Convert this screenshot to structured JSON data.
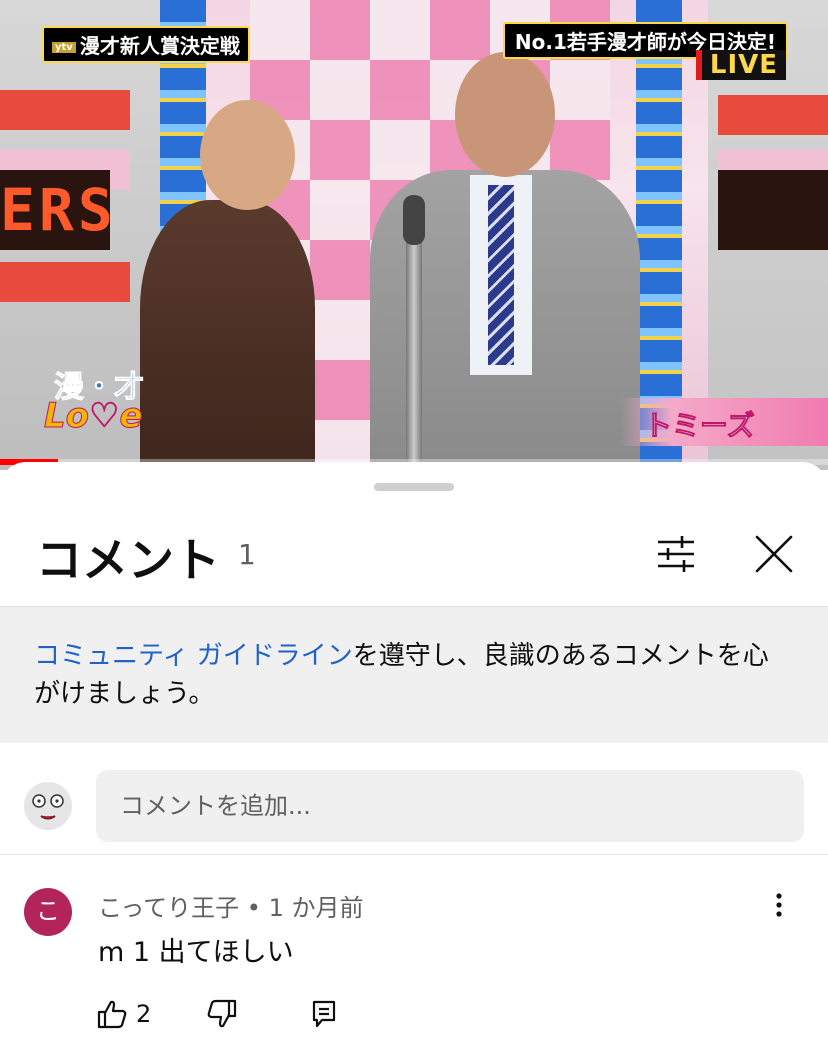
{
  "video": {
    "top_left_logo_sub": "ytv",
    "top_left_logo": "漫才新人賞決定戦",
    "top_right_banner": "No.1若手漫才師が今日決定!",
    "live_badge": "LIVE",
    "led_text": "ERS",
    "show_logo_top": "漫・才",
    "show_logo_bottom": "Lo♡e",
    "name_caption": "トミーズ",
    "progress_fraction": 0.07
  },
  "comments_sheet": {
    "title": "コメント",
    "count": "1",
    "guideline_link": "コミュニティ ガイドライン",
    "guideline_text": "を遵守し、良識のあるコメントを心がけましょう。",
    "add_placeholder": "コメントを追加...",
    "comments": [
      {
        "avatar_letter": "こ",
        "avatar_color": "#b3245a",
        "author": "こってり王子",
        "separator": "•",
        "time": "1 か月前",
        "text": "m 1 出てほしい",
        "like_count": "2"
      }
    ]
  },
  "icons": {
    "filter": "sliders-icon",
    "close": "close-icon",
    "more": "more-vertical-icon",
    "like": "thumbs-up-icon",
    "dislike": "thumbs-down-icon",
    "reply": "reply-comment-icon"
  }
}
